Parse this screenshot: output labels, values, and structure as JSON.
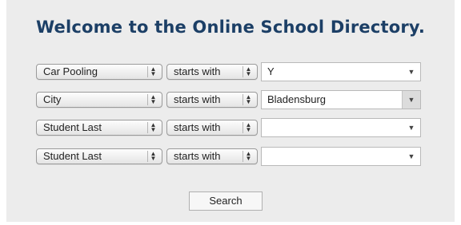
{
  "title": "Welcome to the Online School Directory.",
  "rows": [
    {
      "field": "Car Pooling",
      "operator": "starts with",
      "value": "Y"
    },
    {
      "field": "City",
      "operator": "starts with",
      "value": "Bladensburg"
    },
    {
      "field": "Student Last",
      "operator": "starts with",
      "value": ""
    },
    {
      "field": "Student Last",
      "operator": "starts with",
      "value": ""
    }
  ],
  "search_label": "Search",
  "icons": {
    "stepper": "up-down-arrows-icon",
    "dropdown": "triangle-down-icon"
  }
}
